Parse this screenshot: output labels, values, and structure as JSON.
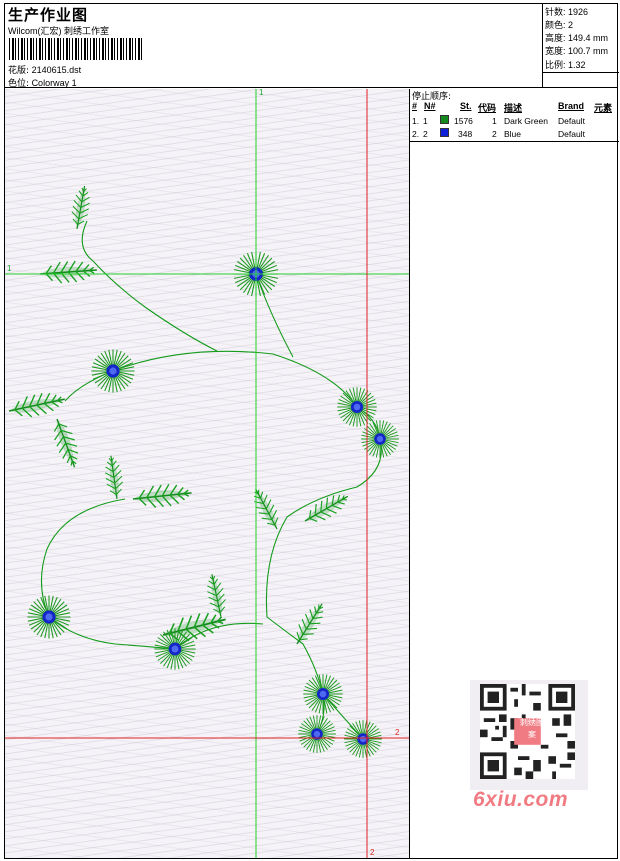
{
  "header": {
    "title": "生产作业图",
    "studio": "Wilcom(汇宏) 刺绣工作室",
    "design_label": "花版:",
    "design_value": "2140615.dst",
    "colorway_label": "色位:",
    "colorway_value": "Colorway 1"
  },
  "stats": [
    {
      "label": "针数:",
      "value": "1926"
    },
    {
      "label": "颜色:",
      "value": "2"
    },
    {
      "label": "高度:",
      "value": "149.4 mm"
    },
    {
      "label": "宽度:",
      "value": "100.7 mm"
    },
    {
      "label": "比例:",
      "value": "1.32"
    }
  ],
  "stop_sequence": {
    "title": "停止顺序:",
    "headers": [
      "#",
      "N#",
      "St.",
      "代码",
      "描述",
      "Brand",
      "元素"
    ],
    "rows": [
      {
        "num": "1.",
        "n": "1",
        "color": "#15891e",
        "st": "1576",
        "code": "1",
        "desc": "Dark Green",
        "brand": "Default"
      },
      {
        "num": "2.",
        "n": "2",
        "color": "#1020d8",
        "st": "348",
        "code": "2",
        "desc": "Blue",
        "brand": "Default"
      }
    ]
  },
  "guides": {
    "green_label_top": "1",
    "green_label_left": "1",
    "red_label_right": "2",
    "red_label_bottom": "2"
  },
  "watermark": {
    "site": "6xiu.com",
    "seal": "刺绣图案"
  }
}
